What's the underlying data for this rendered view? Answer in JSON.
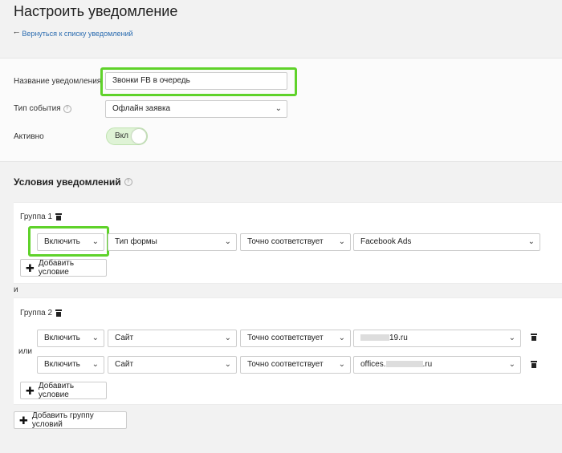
{
  "header": {
    "title": "Настроить уведомление",
    "back_link": "Вернуться к списку уведомлений"
  },
  "form": {
    "name_label": "Название уведомления",
    "name_value": "Звонки FB в очередь",
    "event_label": "Тип события",
    "event_value": "Офлайн заявка",
    "active_label": "Активно",
    "active_toggle_label": "Вкл"
  },
  "conditions": {
    "title": "Условия уведомлений",
    "and_label": "и",
    "or_label": "или",
    "add_condition_label": "Добавить условие",
    "add_group_label": "Добавить группу условий",
    "groups": [
      {
        "label": "Группа 1",
        "rows": [
          {
            "mode": "Включить",
            "field": "Тип формы",
            "operator": "Точно соответствует",
            "value": "Facebook Ads"
          }
        ]
      },
      {
        "label": "Группа 2",
        "rows": [
          {
            "mode": "Включить",
            "field": "Сайт",
            "operator": "Точно соответствует",
            "value": "19.ru"
          },
          {
            "mode": "Включить",
            "field": "Сайт",
            "operator": "Точно соответствует",
            "value": "offices.",
            "value_suffix": ".ru"
          }
        ]
      }
    ]
  },
  "colors": {
    "highlight": "#5fd22a",
    "link": "#2b6cb0",
    "toggle_bg": "#dff3d6"
  }
}
